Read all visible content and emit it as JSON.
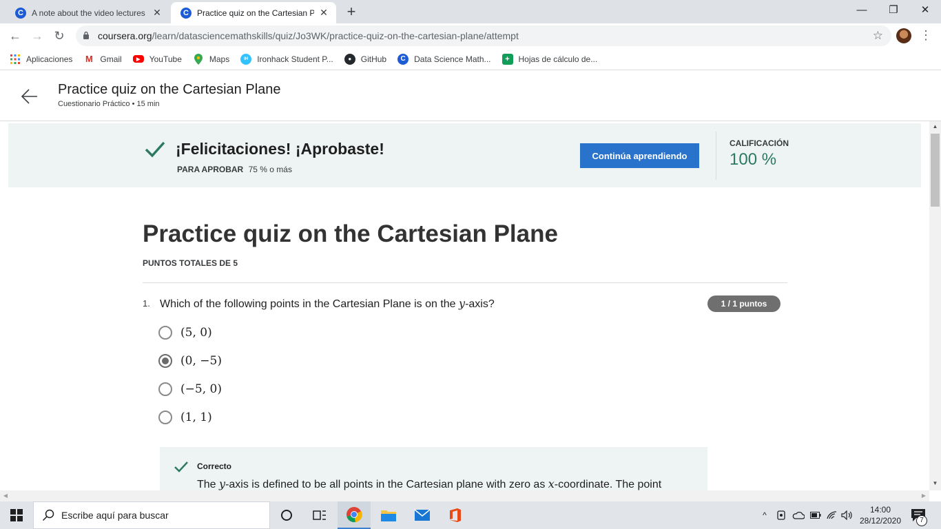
{
  "browser": {
    "tabs": [
      {
        "title": "A note about the video lectures i",
        "favicon": "C",
        "close": "✕"
      },
      {
        "title": "Practice quiz on the Cartesian Pla",
        "favicon": "C",
        "close": "✕"
      }
    ],
    "new_tab": "+",
    "window_controls": {
      "minimize": "—",
      "maximize": "❐",
      "close": "✕"
    },
    "url_host": "coursera.org",
    "url_path": "/learn/datasciencemathskills/quiz/Jo3WK/practice-quiz-on-the-cartesian-plane/attempt",
    "bookmarks": [
      {
        "label": "Aplicaciones",
        "icon": "apps-grid-icon"
      },
      {
        "label": "Gmail",
        "icon": "gmail-icon"
      },
      {
        "label": "YouTube",
        "icon": "youtube-icon"
      },
      {
        "label": "Maps",
        "icon": "maps-pin-icon"
      },
      {
        "label": "Ironhack Student P...",
        "icon": "ironhack-icon"
      },
      {
        "label": "GitHub",
        "icon": "github-icon"
      },
      {
        "label": "Data Science Math...",
        "icon": "coursera-icon"
      },
      {
        "label": "Hojas de cálculo de...",
        "icon": "sheets-icon"
      }
    ]
  },
  "header": {
    "title": "Practice quiz on the Cartesian Plane",
    "subtitle": "Cuestionario Práctico • 15 min"
  },
  "banner": {
    "title": "¡Felicitaciones! ¡Aprobaste!",
    "pass_label": "PARA APROBAR",
    "pass_value": "75 % o más",
    "continue_label": "Continúa aprendiendo",
    "grade_label": "CALIFICACIÓN",
    "grade_value": "100 %",
    "accent_color": "#2b7a5f"
  },
  "quiz": {
    "title": "Practice quiz on the Cartesian Plane",
    "total_points": "PUNTOS TOTALES DE 5",
    "question": {
      "number": "1.",
      "text_before": "Which of the following points in the Cartesian Plane is on the ",
      "text_var": "y",
      "text_after": "-axis?",
      "points_badge": "1 / 1 puntos",
      "options": [
        {
          "label": "(5, 0)",
          "selected": false
        },
        {
          "label": "(0, −5)",
          "selected": true
        },
        {
          "label": "(−5, 0)",
          "selected": false
        },
        {
          "label": "(1, 1)",
          "selected": false
        }
      ],
      "feedback": {
        "title": "Correcto",
        "text_1": "The ",
        "var_1": "y",
        "text_2": "-axis is defined to be all points in the Cartesian plane with zero as ",
        "var_2": "x",
        "text_3": "-coordinate. The point"
      }
    }
  },
  "taskbar": {
    "search_placeholder": "Escribe aquí para buscar",
    "time": "14:00",
    "date": "28/12/2020",
    "notification_count": "7"
  }
}
